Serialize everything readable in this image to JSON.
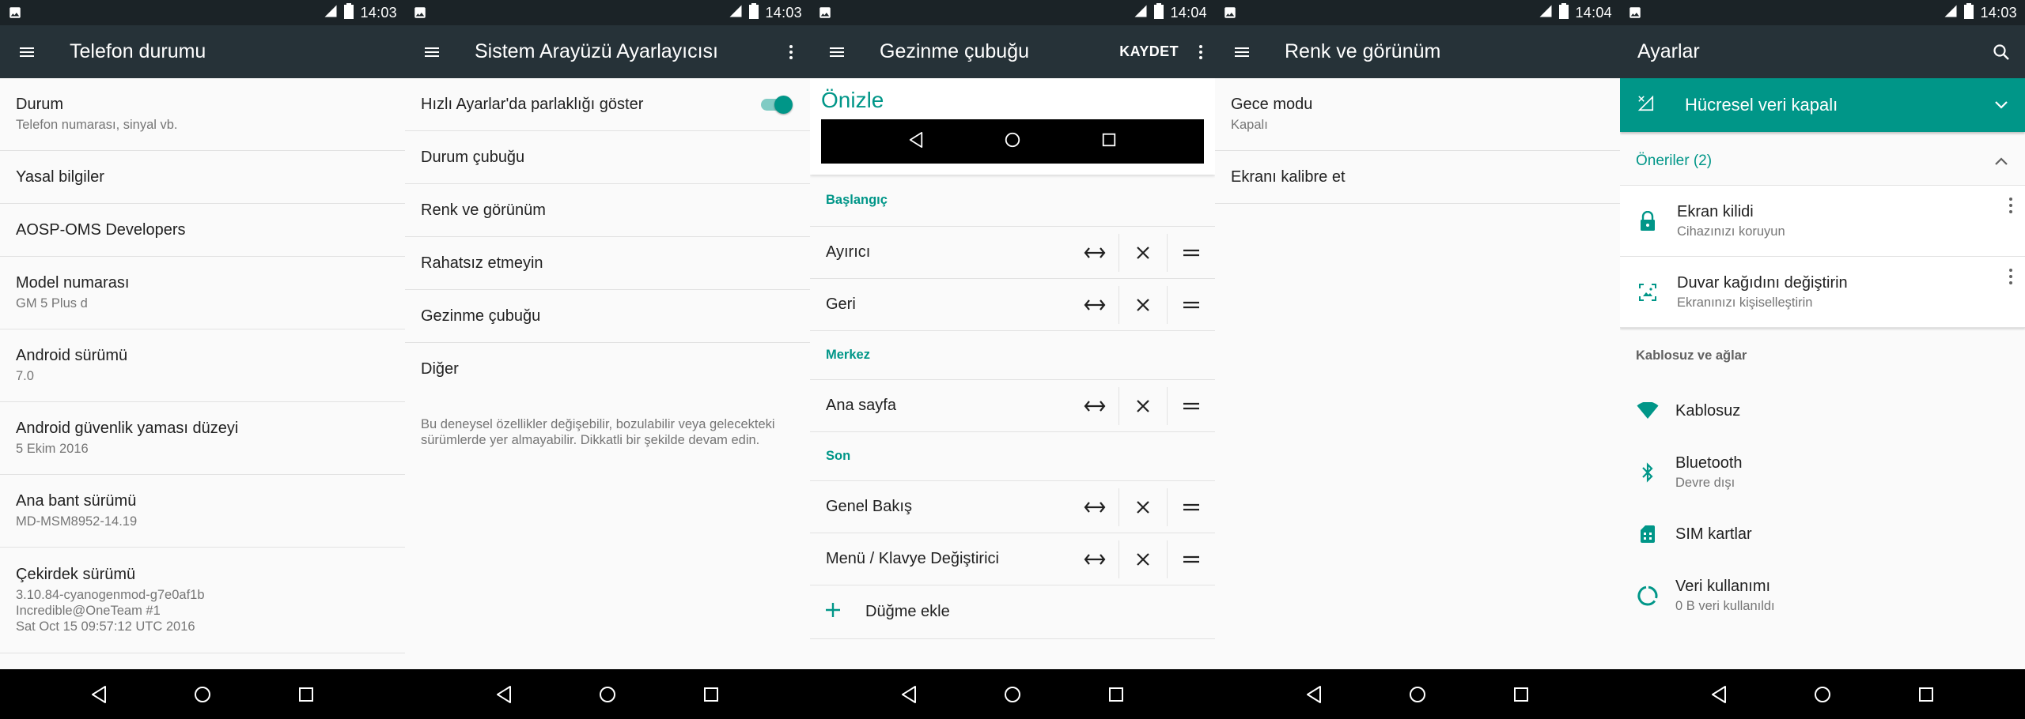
{
  "colors": {
    "toolbar": "#263238",
    "statusbar": "#1b2327",
    "accent": "#009688",
    "background": "#fafafa"
  },
  "screens": [
    {
      "time": "14:03",
      "title": "Telefon durumu",
      "items": [
        {
          "primary": "Durum",
          "secondary": "Telefon numarası, sinyal vb."
        },
        {
          "primary": "Yasal bilgiler"
        },
        {
          "primary": "AOSP-OMS Developers"
        },
        {
          "primary": "Model numarası",
          "secondary": "GM 5 Plus d"
        },
        {
          "primary": "Android sürümü",
          "secondary": "7.0"
        },
        {
          "primary": "Android güvenlik yaması düzeyi",
          "secondary": "5 Ekim 2016"
        },
        {
          "primary": "Ana bant sürümü",
          "secondary": "MD-MSM8952-14.19"
        },
        {
          "primary": "Çekirdek sürümü",
          "secondary_lines": [
            "3.10.84-cyanogenmod-g7e0af1b",
            "Incredible@OneTeam #1",
            "Sat Oct 15 09:57:12 UTC 2016"
          ]
        }
      ]
    },
    {
      "time": "14:03",
      "title": "Sistem Arayüzü Ayarlayıcısı",
      "items": [
        {
          "primary": "Hızlı Ayarlar'da parlaklığı göster",
          "toggle_on": true
        },
        {
          "primary": "Durum çubuğu"
        },
        {
          "primary": "Renk ve görünüm"
        },
        {
          "primary": "Rahatsız etmeyin"
        },
        {
          "primary": "Gezinme çubuğu"
        },
        {
          "primary": "Diğer"
        }
      ],
      "warning": "Bu deneysel özellikler değişebilir, bozulabilir veya gelecekteki sürümlerde yer almayabilir. Dikkatli bir şekilde devam edin."
    },
    {
      "time": "14:04",
      "title": "Gezinme çubuğu",
      "save_label": "KAYDET",
      "preview_title": "Önizle",
      "sections": [
        {
          "header": "Başlangıç",
          "items": [
            "Ayırıcı",
            "Geri"
          ]
        },
        {
          "header": "Merkez",
          "items": [
            "Ana sayfa"
          ]
        },
        {
          "header": "Son",
          "items": [
            "Genel Bakış",
            "Menü / Klavye Değiştirici"
          ]
        }
      ],
      "add_label": "Düğme ekle"
    },
    {
      "time": "14:04",
      "title": "Renk ve görünüm",
      "items": [
        {
          "primary": "Gece modu",
          "secondary": "Kapalı"
        },
        {
          "primary": "Ekranı kalibre et"
        }
      ]
    },
    {
      "time": "14:03",
      "title": "Ayarlar",
      "banner": "Hücresel veri kapalı",
      "suggestions_header": "Öneriler (2)",
      "suggestions": [
        {
          "primary": "Ekran kilidi",
          "secondary": "Cihazınızı koruyun",
          "icon": "lock-icon"
        },
        {
          "primary": "Duvar kağıdını değiştirin",
          "secondary": "Ekranınızı kişiselleştirin",
          "icon": "wallpaper-icon"
        }
      ],
      "category": "Kablosuz ve ağlar",
      "settings": [
        {
          "primary": "Kablosuz",
          "icon": "wifi-icon"
        },
        {
          "primary": "Bluetooth",
          "secondary": "Devre dışı",
          "icon": "bluetooth-icon"
        },
        {
          "primary": "SIM kartlar",
          "icon": "sim-card-icon"
        },
        {
          "primary": "Veri kullanımı",
          "secondary": "0 B veri kullanıldı",
          "icon": "data-usage-icon"
        }
      ]
    }
  ]
}
